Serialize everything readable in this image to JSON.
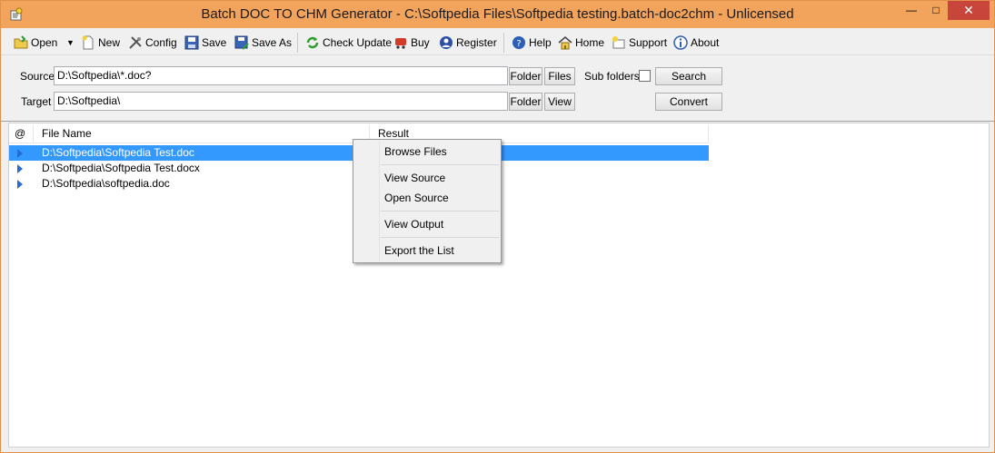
{
  "window": {
    "title": "Batch DOC TO CHM Generator - C:\\Softpedia Files\\Softpedia testing.batch-doc2chm - Unlicensed",
    "minimize": "—",
    "maximize": "□",
    "close": "✕",
    "accent": "#f2a45c"
  },
  "toolbar": {
    "open": "Open",
    "new": "New",
    "config": "Config",
    "save": "Save",
    "save_as": "Save As",
    "check_update": "Check Update",
    "buy": "Buy",
    "register": "Register",
    "help": "Help",
    "home": "Home",
    "support": "Support",
    "about": "About"
  },
  "form": {
    "source_label": "Source",
    "source_value": "D:\\Softpedia\\*.doc?",
    "target_label": "Target",
    "target_value": "D:\\Softpedia\\",
    "folder_btn": "Folder",
    "files_btn": "Files",
    "view_btn": "View",
    "subfolders_label": "Sub folders",
    "subfolders_checked": false,
    "search_btn": "Search",
    "convert_btn": "Convert"
  },
  "list": {
    "columns": [
      "@",
      "File Name",
      "Result"
    ],
    "rows": [
      {
        "file": "D:\\Softpedia\\Softpedia Test.doc",
        "result": "",
        "selected": true
      },
      {
        "file": "D:\\Softpedia\\Softpedia Test.docx",
        "result": "",
        "selected": false
      },
      {
        "file": "D:\\Softpedia\\softpedia.doc",
        "result": "",
        "selected": false
      }
    ]
  },
  "context_menu": {
    "items": [
      "Browse Files",
      "View  Source",
      "Open Source",
      "View  Output",
      "Export the List"
    ]
  }
}
